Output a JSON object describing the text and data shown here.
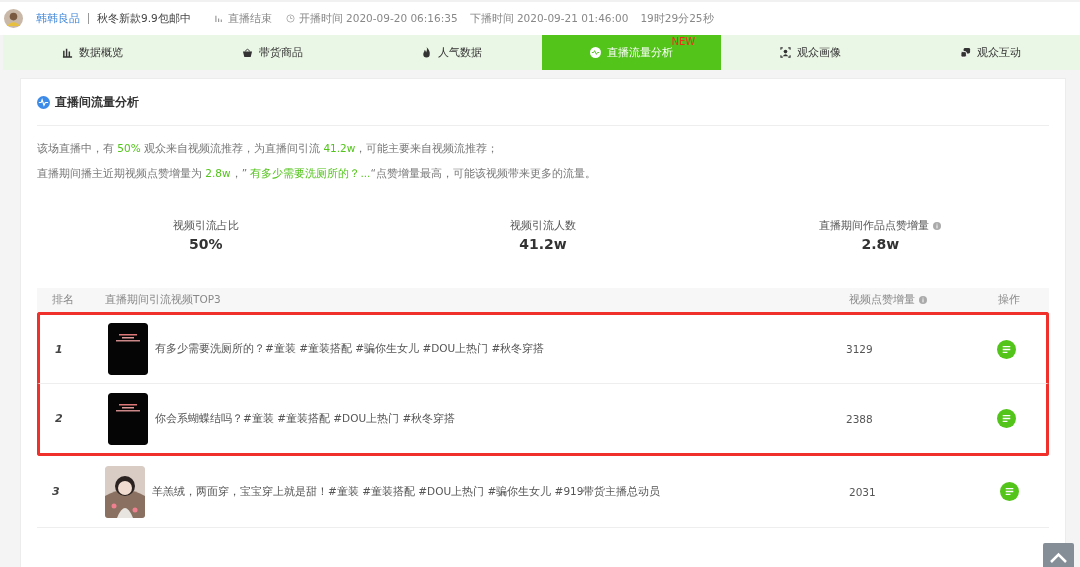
{
  "header": {
    "shop_name": "韩韩良品",
    "promo": "秋冬新款9.9包邮中",
    "status": "直播结束",
    "start": "开播时间 2020-09-20 06:16:35",
    "end": "下播时间 2020-09-21 01:46:00",
    "duration": "19时29分25秒"
  },
  "tabs": [
    {
      "label": "数据概览",
      "selected": false
    },
    {
      "label": "带货商品",
      "selected": false
    },
    {
      "label": "人气数据",
      "selected": false
    },
    {
      "label": "直播流量分析",
      "selected": true,
      "badge": "NEW"
    },
    {
      "label": "观众画像",
      "selected": false
    },
    {
      "label": "观众互动",
      "selected": false
    }
  ],
  "section": {
    "title": "直播间流量分析",
    "summary": [
      "该场直播中，有 **50%** 观众来自视频流推荐，为直播间引流 **41.2w**，可能主要来自视频流推荐；",
      "直播期间播主近期视频点赞增量为 **2.8w**，” **有多少需要洗厕所的？...**“点赞增量最高，可能该视频带来更多的流量。"
    ],
    "stats": [
      {
        "label": "视频引流占比",
        "value": "50%",
        "info": false
      },
      {
        "label": "视频引流人数",
        "value": "41.2w",
        "info": false
      },
      {
        "label": "直播期间作品点赞增量",
        "value": "2.8w",
        "info": true
      }
    ],
    "table": {
      "columns": [
        "排名",
        "直播期间引流视频TOP3",
        "视频点赞增量",
        "操作"
      ],
      "rows": [
        {
          "rank": "1",
          "title": "有多少需要洗厕所的？#童装 #童装搭配 #骗你生女儿 #DOU上热门 #秋冬穿搭",
          "likes": "3129",
          "highlighted": true
        },
        {
          "rank": "2",
          "title": "你会系蝴蝶结吗？#童装 #童装搭配 #DOU上热门 #秋冬穿搭",
          "likes": "2388",
          "highlighted": true
        },
        {
          "rank": "3",
          "title": "羊羔绒，两面穿，宝宝穿上就是甜！#童装 #童装搭配 #DOU上热门 #骗你生女儿 #919带货主播总动员",
          "likes": "2031",
          "highlighted": false
        }
      ]
    }
  }
}
